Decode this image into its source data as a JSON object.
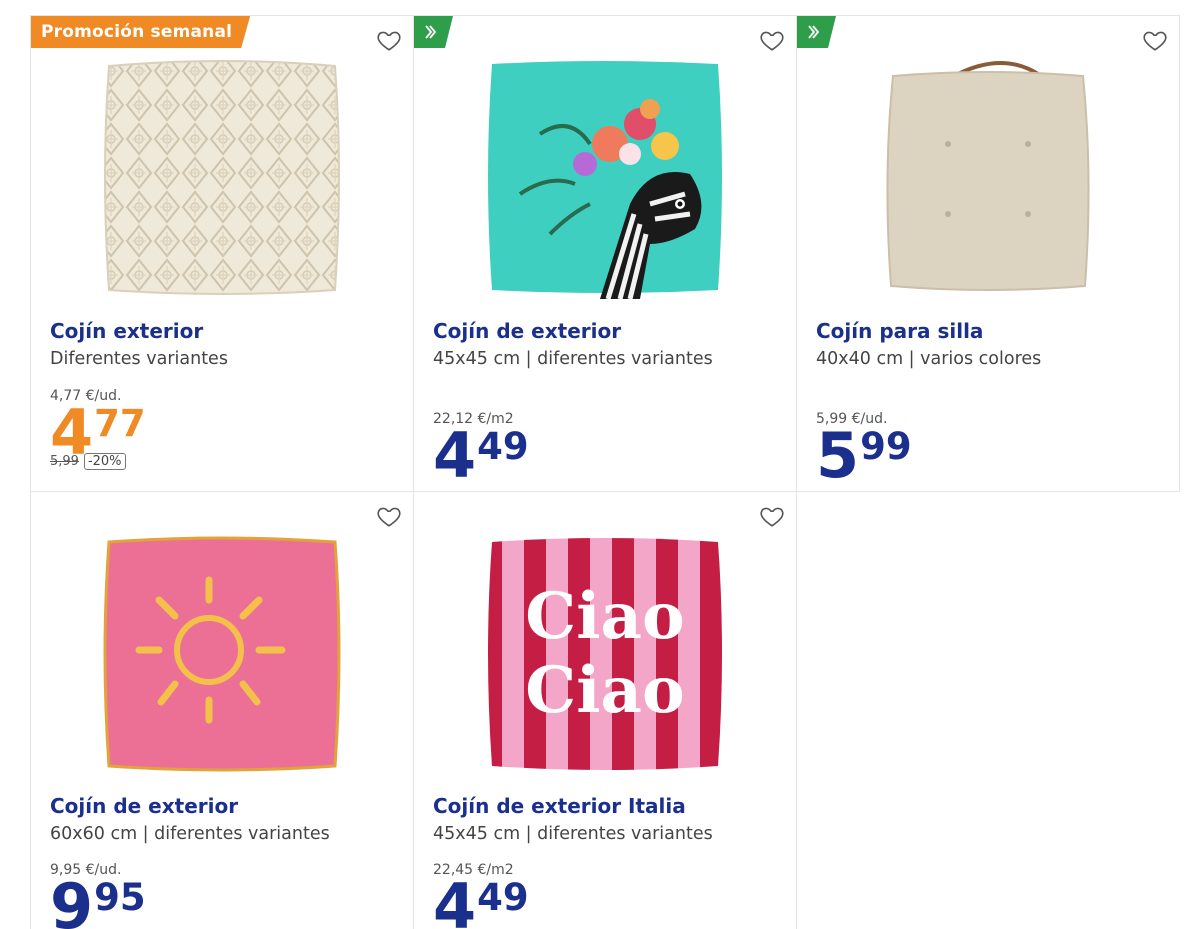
{
  "products": [
    {
      "promo_label": "Promoción semanal",
      "title": "Cojín exterior",
      "subtitle": "Diferentes variantes",
      "unit_price": "4,77 €/ud.",
      "price_int": "4",
      "price_dec": "77",
      "old_price": "5,99",
      "discount": "-20%"
    },
    {
      "title": "Cojín de exterior",
      "subtitle": "45x45 cm | diferentes variantes",
      "unit_price": "22,12 €/m2",
      "price_int": "4",
      "price_dec": "49"
    },
    {
      "title": "Cojín para silla",
      "subtitle": "40x40 cm | varios colores",
      "unit_price": "5,99 €/ud.",
      "price_int": "5",
      "price_dec": "99"
    },
    {
      "title": "Cojín de exterior",
      "subtitle": "60x60 cm | diferentes variantes",
      "unit_price": "9,95 €/ud.",
      "price_int": "9",
      "price_dec": "95"
    },
    {
      "title": "Cojín de exterior Italia",
      "subtitle": "45x45 cm | diferentes variantes",
      "unit_price": "22,45 €/m2",
      "price_int": "4",
      "price_dec": "49",
      "image_text": [
        "Ciao",
        "Ciao"
      ]
    }
  ],
  "colors": {
    "brand_blue": "#1b2f8c",
    "promo_orange": "#f08a24",
    "fast_green": "#2e9e4a"
  },
  "icons": {
    "favorite": "heart-outline-icon",
    "fast_delivery": "speed-lines-icon"
  }
}
